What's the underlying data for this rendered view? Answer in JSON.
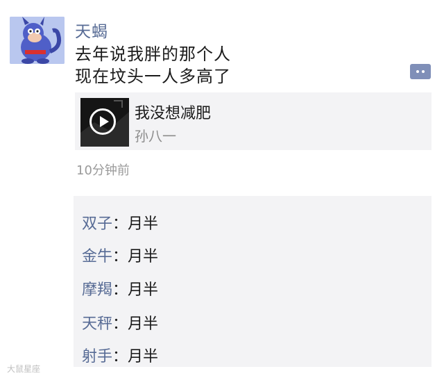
{
  "post": {
    "username": "天蝎",
    "lines": [
      "去年说我胖的那个人",
      "现在坟头一人多高了"
    ],
    "timestamp": "10分钟前",
    "more_icon": "more-dots-icon"
  },
  "music_card": {
    "title": "我没想减肥",
    "artist": "孙八一",
    "icon": "play-icon"
  },
  "comments": [
    {
      "who": "双子",
      "sep": "：",
      "msg": "月半"
    },
    {
      "who": "金牛",
      "sep": "：",
      "msg": "月半"
    },
    {
      "who": "摩羯",
      "sep": "：",
      "msg": "月半"
    },
    {
      "who": "天秤",
      "sep": "：",
      "msg": "月半"
    },
    {
      "who": "射手",
      "sep": "：",
      "msg": "月半"
    }
  ],
  "watermark": "大鼠星座",
  "colors": {
    "link": "#576b95",
    "panel": "#f3f3f5",
    "more_button": "#7f8fb8"
  }
}
